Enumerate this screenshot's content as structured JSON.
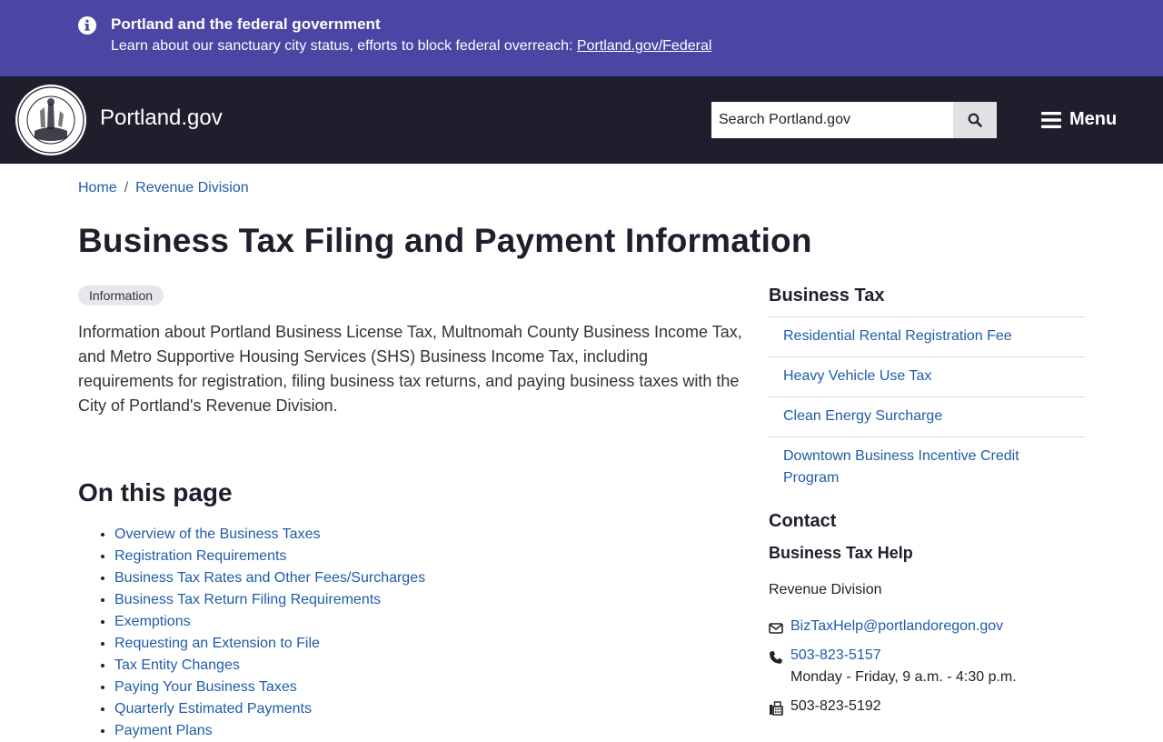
{
  "alert": {
    "title": "Portland and the federal government",
    "text": "Learn about our sanctuary city status, efforts to block federal overreach: ",
    "link": "Portland.gov/Federal"
  },
  "header": {
    "site_name": "Portland.gov",
    "search_placeholder": "Search Portland.gov",
    "menu_label": "Menu"
  },
  "breadcrumb": [
    {
      "label": "Home"
    },
    {
      "label": "Revenue Division"
    }
  ],
  "main": {
    "title": "Business Tax Filing and Payment Information",
    "badge": "Information",
    "intro": "Information about Portland Business License Tax, Multnomah County Business Income Tax, and Metro Supportive Housing Services (SHS) Business Income Tax, including requirements for registration, filing business tax returns, and paying business taxes with the City of Portland's Revenue Division.",
    "toc_title": "On this page",
    "toc": [
      "Overview of the Business Taxes",
      "Registration Requirements",
      "Business Tax Rates and Other Fees/Surcharges",
      "Business Tax Return Filing Requirements",
      "Exemptions",
      "Requesting an Extension to File",
      "Tax Entity Changes",
      "Paying Your Business Taxes",
      "Quarterly Estimated Payments",
      "Payment Plans"
    ]
  },
  "sidebar": {
    "title": "Business Tax",
    "items": [
      "Residential Rental Registration Fee",
      "Heavy Vehicle Use Tax",
      "Clean Energy Surcharge",
      "Downtown Business Incentive Credit Program"
    ]
  },
  "contact": {
    "title": "Contact",
    "name": "Business Tax Help",
    "org": "Revenue Division",
    "email": "BizTaxHelp@portlandoregon.gov",
    "phone": "503-823-5157",
    "hours": "Monday - Friday, 9 a.m. - 4:30 p.m.",
    "fax": "503-823-5192"
  },
  "colors": {
    "banner": "#4b46a4",
    "header": "#1e1e2d",
    "link": "#1f5ca8"
  }
}
